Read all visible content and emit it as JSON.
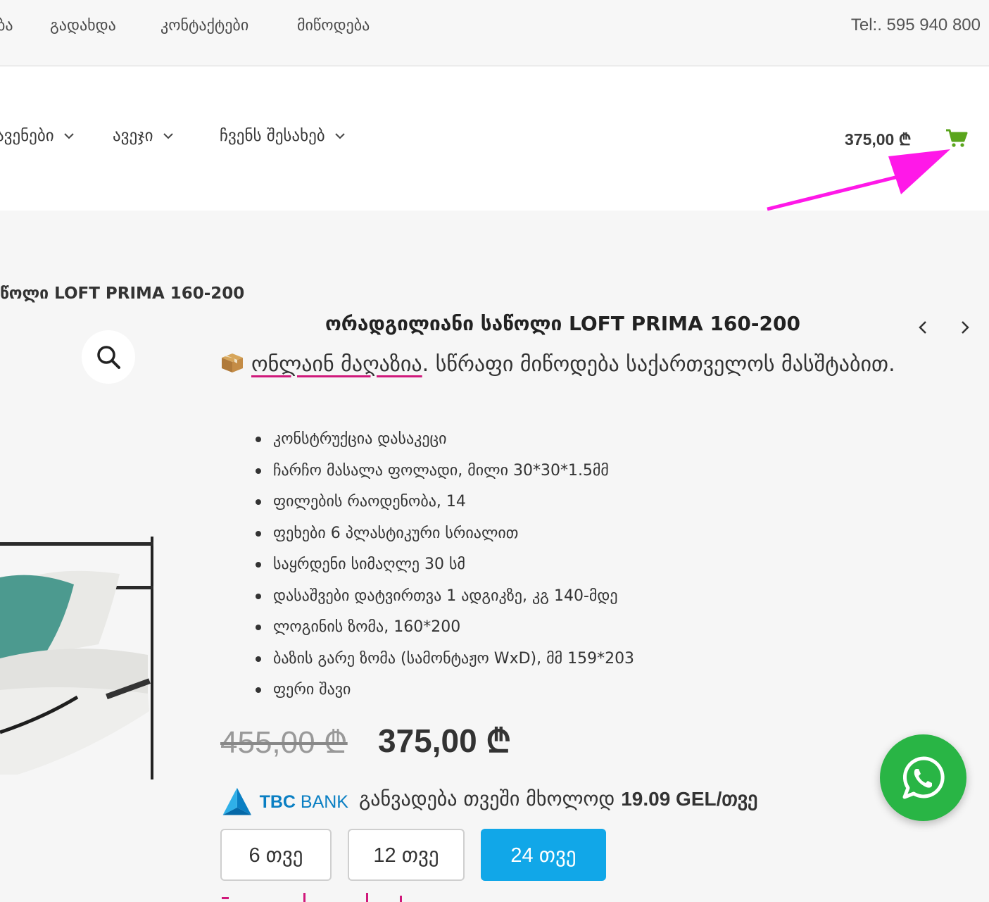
{
  "topbar": {
    "links": [
      "ბა",
      "გადახდა",
      "კონტაქტები",
      "მიწოდება"
    ],
    "tel": "Tel:. 595 940 800"
  },
  "nav": {
    "items": [
      "ავენები",
      "ავეჯი",
      "ჩვენს შესახებ"
    ],
    "cart_total": "375,00 ₾"
  },
  "breadcrumb_title": "წოლი LOFT PRIMA 160-200",
  "product": {
    "title": "ორადგილიანი საწოლი LOFT PRIMA 160-200",
    "shop_link": "ონლაინ მაღაზია",
    "shop_rest": ". სწრაფი მიწოდება საქართველოს მასშტაბით.",
    "specs": [
      "კონსტრუქცია დასაკეცი",
      "ჩარჩო მასალა  ფოლადი, მილი 30*30*1.5მმ",
      "ფილების რაოდენობა, 14",
      "ფეხები 6 პლასტიკური სრიალით",
      "საყრდენი სიმაღლე 30 სმ",
      "დასაშვები დატვირთვა 1 ადგიკზე, კგ  140-მდე",
      "ლოგინის ზომა, 160*200",
      "ბაზის გარე ზომა (სამონტაჟო WxD), მმ  159*203",
      "ფერი  შავი"
    ],
    "old_price": "455,00 ₾",
    "new_price": "375,00 ₾"
  },
  "installment": {
    "bank_tbc": "TBC",
    "bank_word": "BANK",
    "text": "განვადება თვეში მხოლოდ ",
    "amount": "19.09 GEL/თვე",
    "terms": [
      "6 თვე",
      "12 თვე",
      "24 თვე"
    ],
    "active_term": "24 თვე"
  },
  "colors": {
    "accent_pink": "#d0197b",
    "annotation_arrow": "#ff18e8",
    "cart_green": "#5aa51c",
    "whatsapp_green": "#29b545",
    "term_active_blue": "#11a7e8",
    "tbc_blue": "#0a7fc3"
  },
  "icons": [
    "chevron-down-icon",
    "cart-icon",
    "search-icon",
    "chevron-left-icon",
    "chevron-right-icon",
    "package-icon",
    "tbc-logo-icon",
    "whatsapp-icon",
    "annotation-arrow"
  ]
}
